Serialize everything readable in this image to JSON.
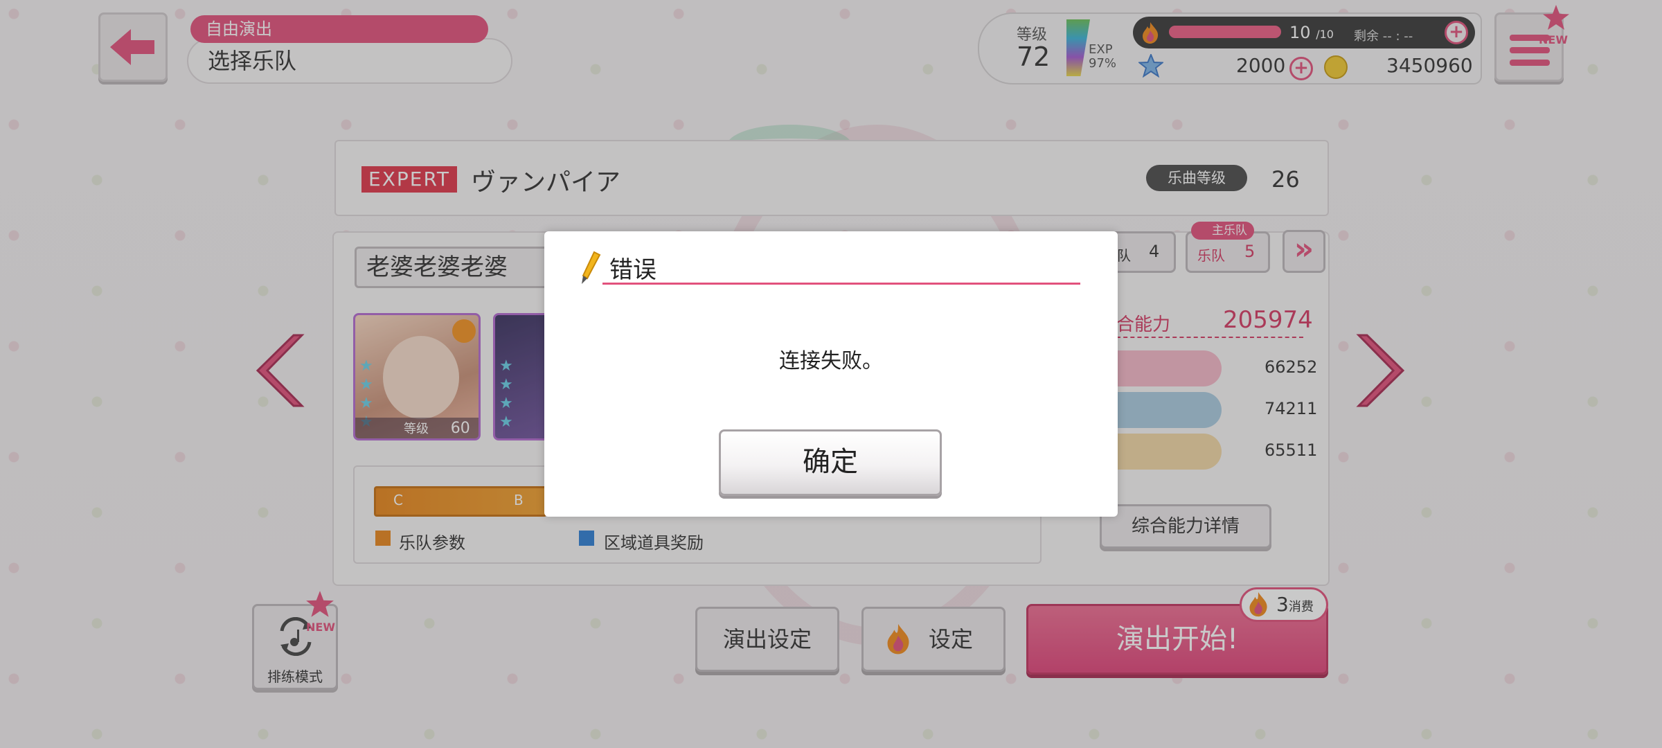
{
  "header": {
    "section": "自由演出",
    "title": "选择乐队"
  },
  "status": {
    "level_label": "等级",
    "level": "72",
    "exp_label": "EXP",
    "exp_percent": "97%",
    "stamina_current": "10",
    "stamina_max": "/10",
    "remaining_label": "剩余",
    "remaining_time": "-- : --",
    "stars": "2000",
    "coins": "3450960",
    "new_badge": "NEW"
  },
  "song": {
    "difficulty": "EXPERT",
    "title": "ヴァンパイア",
    "level_label": "乐曲等级",
    "level": "26"
  },
  "band": {
    "name": "老婆老婆老婆",
    "tab_prev_label": "队",
    "tab_prev_num": "4",
    "tab_main_badge": "主乐队",
    "tab_main_label": "乐队",
    "tab_main_num": "5",
    "next_label": "»",
    "cards": [
      {
        "level_label": "等级",
        "level": "60"
      }
    ],
    "param_ticks": [
      "C",
      "B"
    ],
    "legend": [
      "乐队参数",
      "区域道具奖励"
    ],
    "power_label": "合能力",
    "power": "205974",
    "stats": [
      "66252",
      "74211",
      "65511"
    ],
    "detail_button": "综合能力详情"
  },
  "bottom": {
    "rehearsal_label": "排练模式",
    "rehearsal_badge": "NEW",
    "performance_settings": "演出设定",
    "settings": "设定",
    "start": "演出开始!",
    "cost": "3",
    "cost_label": "消费"
  },
  "modal": {
    "title": "错误",
    "message": "连接失败。",
    "ok": "确定"
  },
  "colors": {
    "accent": "#e2517c",
    "expert": "#e0364a",
    "stat1": "#f4b8c8",
    "stat2": "#a9cbe0",
    "stat3": "#f1d7a6"
  }
}
